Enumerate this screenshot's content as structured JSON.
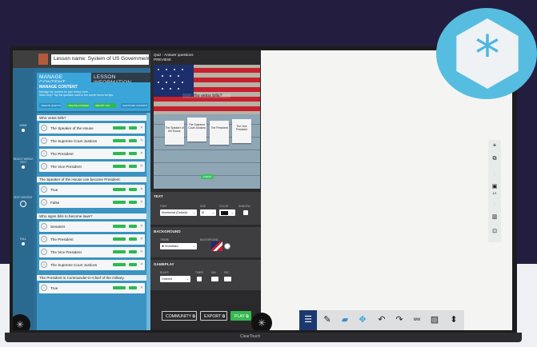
{
  "editor": {
    "lesson_name_label": "Lesson name: System of US Government",
    "tabs": [
      {
        "label": "MANAGE CONTENT",
        "active": true
      },
      {
        "label": "LESSON INFORMATION",
        "active": false
      }
    ],
    "manage": {
      "title": "MANAGE CONTENT",
      "desc_line1": "Manage the content for your lesson here.",
      "desc_line2": "Need help? Tap the question mark in the corner menu for tips.",
      "buttons": [
        {
          "label": "CREATE QUESTION",
          "color": "#3aa5d9"
        },
        {
          "label": "CREATE ANSWER",
          "color": "#2eb94f"
        },
        {
          "label": "IMPORT CSV",
          "color": "#2eb94f"
        },
        {
          "label": "SORT/FIND CONTENT",
          "color": "#3aa5d9"
        }
      ]
    },
    "rail": [
      {
        "label": "NONE"
      },
      {
        "label": "SELECT WHOLE TEXT"
      },
      {
        "label": "EDIT CONTENT"
      },
      {
        "label": "FULL"
      }
    ],
    "questions": [
      {
        "text": "Who vetos bills?",
        "answers": [
          "The Speaker of the House",
          "The Supreme Court Justices",
          "The President",
          "The Vice President"
        ]
      },
      {
        "text": "The Speaker of the House can become President.",
        "answers": [
          "True",
          "False"
        ]
      },
      {
        "text": "Who signs bills to become laws?",
        "answers": [
          "Senators",
          "The President",
          "The Vice President",
          "The Supreme Court Justices"
        ]
      },
      {
        "text": "The President is Commander-in-Chief of the military.",
        "answers": [
          "True"
        ]
      }
    ]
  },
  "center": {
    "header_line1": "Quiz - Answer questions",
    "header_line2": "PREVIEW:",
    "preview_question": "Who vetos bills?",
    "preview_cards": [
      "The Speaker of the House",
      "The Supreme Court Justices",
      "The President",
      "The Vice President"
    ],
    "preview_check": "CHECK",
    "text_section": {
      "title": "TEXT",
      "font_label": "FONT",
      "font_value": "Montserrat (Default)",
      "size_label": "SIZE",
      "size_value": "M",
      "color_label": "COLOR",
      "shadow_label": "SHADOW"
    },
    "background_section": {
      "title": "BACKGROUND",
      "theme_label": "THEME",
      "theme_value": "Snowflake",
      "background_label": "BACKGROUND"
    },
    "gameplay_section": {
      "title": "GAMEPLAY",
      "rules_label": "RULES",
      "rules_value": "Ordered",
      "timer_label": "TIMER",
      "min_label": "MIN",
      "sec_label": "SEC"
    },
    "buttons": {
      "community": "COMMUNITY",
      "export": "EXPORT",
      "play": "PLAY"
    }
  },
  "toolbar_icons": [
    "menu-icon",
    "pen-icon",
    "eraser-icon",
    "move-icon",
    "undo-icon",
    "redo-icon",
    "text-icon",
    "image-icon",
    "stamp-icon"
  ],
  "right_tools": [
    "zoom-in-icon",
    "duplicate-icon",
    "pages-icon",
    "delete-icon",
    "fit-icon"
  ],
  "right_tools_page_counter": "1/1",
  "brand_logo": "ClearTouch",
  "colors": {
    "accent_blue": "#3aa5d9",
    "accent_green": "#2eb94f",
    "badge_blue": "#57bde0",
    "menu_navy": "#1c3970"
  }
}
